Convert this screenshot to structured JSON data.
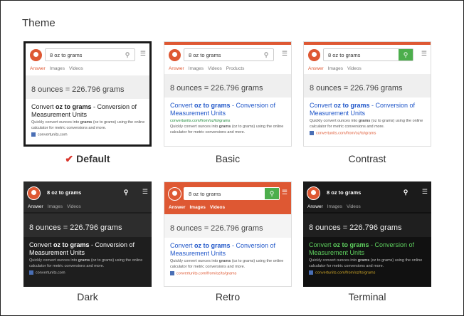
{
  "heading": "Theme",
  "preview": {
    "query": "8 oz to grams",
    "tabs_full": [
      "Answer",
      "Images",
      "Videos",
      "Products"
    ],
    "tabs_short": [
      "Answer",
      "Images",
      "Videos"
    ],
    "answer": "8 ounces = 226.796 grams",
    "result_title_a": "Convert ",
    "result_title_b": "oz to grams",
    "result_title_c": " - Conversion of Measurement Units",
    "result_url": "convertunits.com/from/oz/to/grams",
    "result_desc_a": "Quickly convert ounces into ",
    "result_desc_b": "grams",
    "result_desc_c": " (oz to grams) using the online calculator for metric conversions and more.",
    "result_site": "convertunits.com"
  },
  "themes": [
    {
      "name": "Default",
      "selected": true
    },
    {
      "name": "Basic",
      "selected": false
    },
    {
      "name": "Contrast",
      "selected": false
    },
    {
      "name": "Dark",
      "selected": false
    },
    {
      "name": "Retro",
      "selected": false
    },
    {
      "name": "Terminal",
      "selected": false
    }
  ],
  "colors": {
    "accent": "#de5833",
    "link_blue": "#1f56c9",
    "url_green": "#1d8a3a",
    "contrast_green": "#4cae4c",
    "terminal_green": "#5fd15f",
    "terminal_url": "#c9a227"
  },
  "icons": {
    "search": "magnifier-icon",
    "menu": "hamburger-icon",
    "check": "checkmark-icon"
  }
}
